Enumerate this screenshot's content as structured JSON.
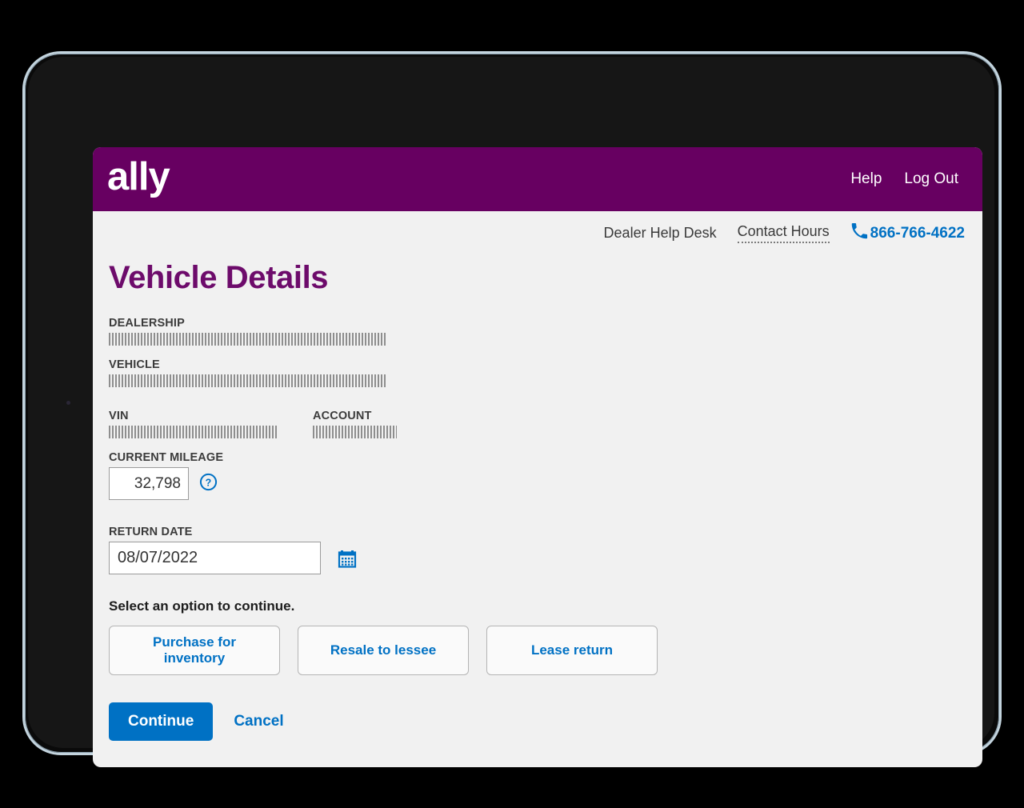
{
  "header": {
    "brand": "ally",
    "nav": [
      {
        "label": "Help",
        "name": "help-link"
      },
      {
        "label": "Log Out",
        "name": "log-out-link"
      }
    ]
  },
  "helpdesk": {
    "label": "Dealer Help Desk",
    "contact_hours": "Contact Hours",
    "phone": "866-766-4622",
    "phone_icon": "phone-icon"
  },
  "main": {
    "title": "Vehicle Details",
    "fields": {
      "dealership_label": "DEALERSHIP",
      "dealership_value": "",
      "vehicle_label": "VEHICLE",
      "vehicle_value": "",
      "vin_label": "VIN",
      "vin_value": "",
      "account_label": "ACCOUNT",
      "account_value": "",
      "mileage_label": "CURRENT MILEAGE",
      "mileage_value": "32,798",
      "mileage_help_icon": "help-circle-icon",
      "return_date_label": "RETURN DATE",
      "return_date_value": "08/07/2022",
      "calendar_icon": "calendar-icon"
    },
    "select_prompt": "Select an option to continue.",
    "options": [
      {
        "label": "Purchase for inventory",
        "name": "option-purchase-for-inventory"
      },
      {
        "label": "Resale to lessee",
        "name": "option-resale-to-lessee"
      },
      {
        "label": "Lease return",
        "name": "option-lease-return"
      }
    ],
    "actions": {
      "continue_label": "Continue",
      "cancel_label": "Cancel"
    }
  },
  "colors": {
    "brand_purple": "#670061",
    "title_purple": "#6d0b6b",
    "accent_blue": "#0071c4",
    "page_bg": "#f1f1f1"
  }
}
